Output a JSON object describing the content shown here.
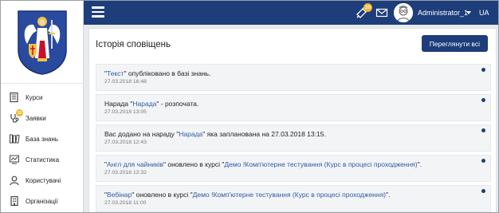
{
  "sidebar": {
    "items": [
      {
        "label": "Курси",
        "icon": "courses-icon"
      },
      {
        "label": "Заявки",
        "icon": "requests-icon",
        "badge": "10"
      },
      {
        "label": "База знань",
        "icon": "knowledge-base-icon"
      },
      {
        "label": "Статистика",
        "icon": "statistics-icon"
      },
      {
        "label": "Користувачі",
        "icon": "users-icon"
      },
      {
        "label": "Організації",
        "icon": "organizations-icon"
      }
    ]
  },
  "topbar": {
    "notifications_badge": "20",
    "username": "Administrator_1",
    "language": "UA"
  },
  "main": {
    "title": "Історія сповіщень",
    "view_all_label": "Переглянути всі"
  },
  "notifications": [
    {
      "pre": "\"",
      "link": "Текст",
      "post": "\" опубліковано в базі знань.",
      "link2": "",
      "post2": "",
      "date": "27.03.2018 16:48"
    },
    {
      "pre": "Нарада \"",
      "link": "Нарада",
      "post": "\" - розпочата.",
      "link2": "",
      "post2": "",
      "date": "27.03.2018 13:05"
    },
    {
      "pre": "Вас додано на нараду \"",
      "link": "Нарада",
      "post": "\" яка запланована на 27.03.2018 13:15.",
      "link2": "",
      "post2": "",
      "date": "27.03.2018 12:43"
    },
    {
      "pre": "\"",
      "link": "Англ для чайників",
      "post": "\" оновлено в курсі \"",
      "link2": "Демо !Комп'ютерне тестування (Курс в процесі проходження)",
      "post2": "\".",
      "date": "27.03.2018 12:32"
    },
    {
      "pre": "\"",
      "link": "Вебінар",
      "post": "\" оновлено в курсі \"",
      "link2": "Демо !Комп'ютерне тестування (Курс в процесі проходження)",
      "post2": "\".",
      "date": "27.03.2018 11:00"
    }
  ],
  "colors": {
    "brand": "#1e3d7b",
    "badge": "#f0b429",
    "link": "#2f5aa8"
  }
}
